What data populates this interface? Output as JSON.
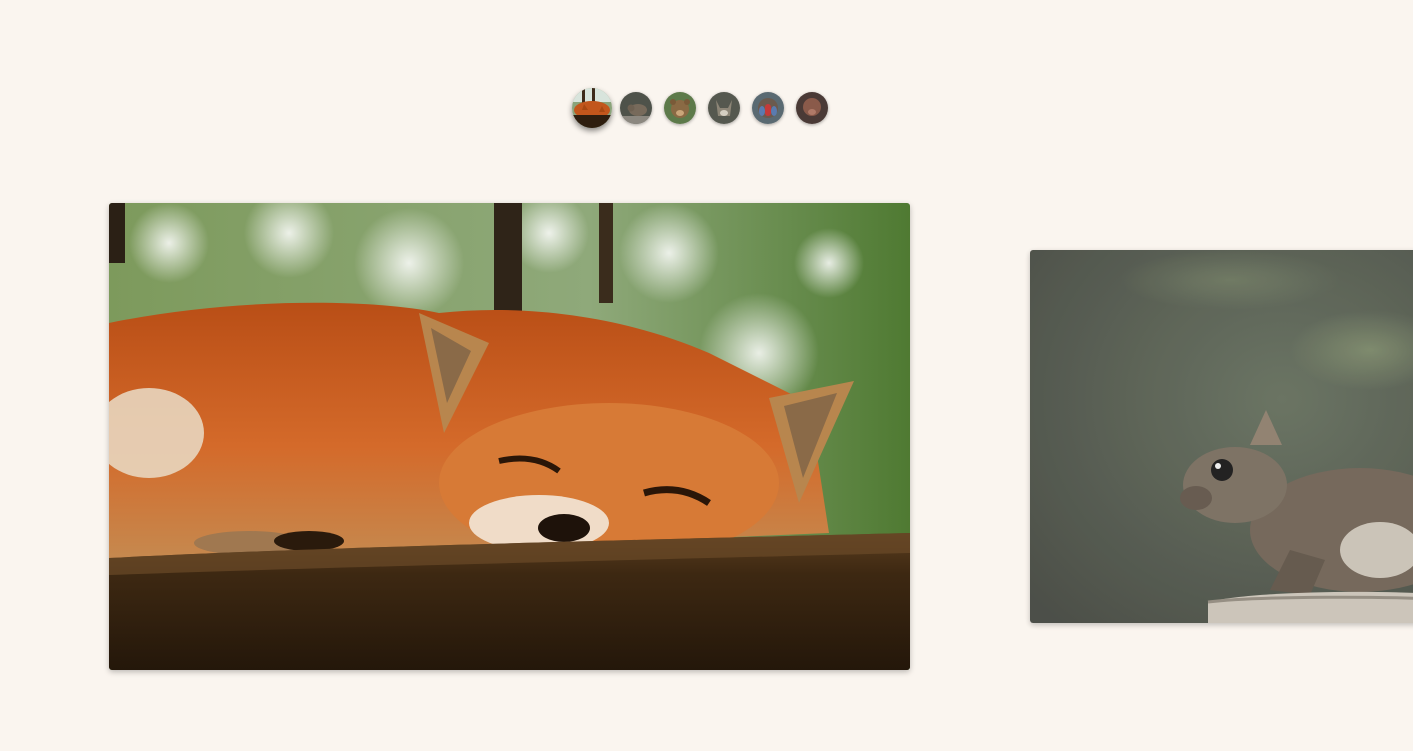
{
  "gallery": {
    "active_index": 0,
    "thumbnails": [
      {
        "icon": "fox-thumbnail",
        "active": true
      },
      {
        "icon": "squirrel-thumbnail",
        "active": false
      },
      {
        "icon": "bear-thumbnail",
        "active": false
      },
      {
        "icon": "wolf-thumbnail",
        "active": false
      },
      {
        "icon": "mandrill-thumbnail",
        "active": false
      },
      {
        "icon": "animal-thumbnail",
        "active": false
      }
    ],
    "slides": [
      {
        "subject": "fox-image",
        "state": "current"
      },
      {
        "subject": "squirrel-image",
        "state": "next"
      }
    ]
  },
  "colors": {
    "background": "#faf5ef",
    "fox_fur": "#c2561c",
    "foliage": "#6f8f4a",
    "wood": "#3b2714",
    "squirrel_bg": "#4c5247",
    "squirrel_fur": "#6b5e50"
  }
}
